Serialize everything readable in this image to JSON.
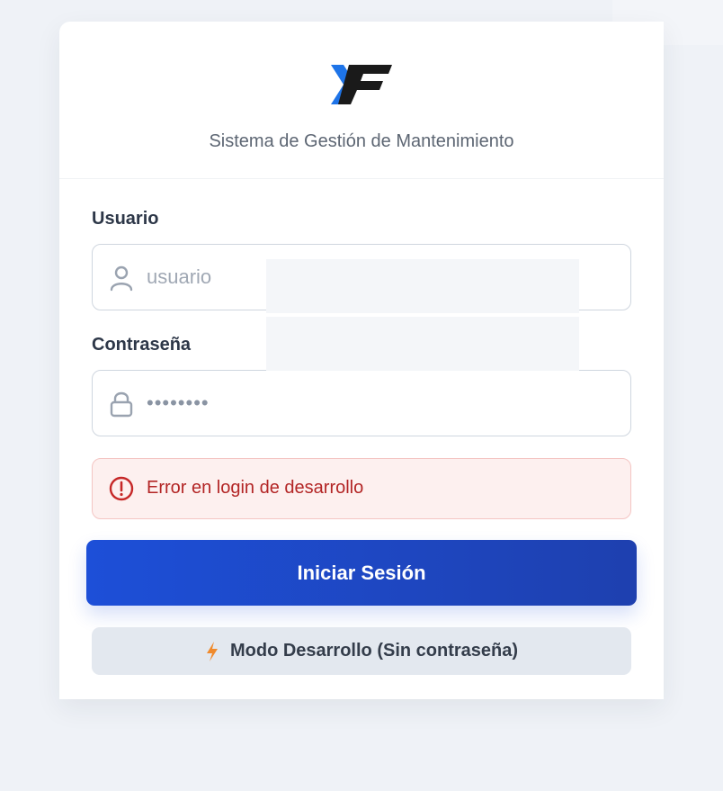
{
  "header": {
    "subtitle": "Sistema de Gestión de Mantenimiento"
  },
  "form": {
    "user_label": "Usuario",
    "user_placeholder": "usuario",
    "password_label": "Contraseña",
    "password_value": "••••••••"
  },
  "error": {
    "message": "Error en login de desarrollo"
  },
  "actions": {
    "login_label": "Iniciar Sesión",
    "dev_mode_label": "Modo Desarrollo (Sin contraseña)"
  },
  "colors": {
    "primary": "#1d4fd8",
    "logo_blue": "#1e74e8",
    "logo_dark": "#1a1a1a",
    "error_text": "#b32525",
    "error_bg": "#fdf0ef",
    "bolt": "#f08a2c"
  },
  "icons": {
    "user_field": "user-icon",
    "password_field": "lock-icon",
    "error": "alert-circle-icon",
    "dev_mode": "lightning-bolt-icon"
  }
}
